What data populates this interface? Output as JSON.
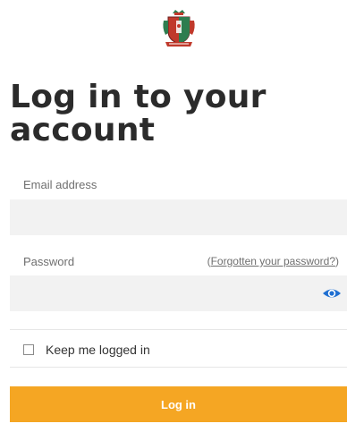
{
  "header": {
    "logo_icon": "crest-logo-icon"
  },
  "page": {
    "title_line1": "Log in to your",
    "title_line2": "account"
  },
  "form": {
    "email_label": "Email address",
    "email_value": "",
    "password_label": "Password",
    "password_value": "",
    "forgot_open": "(",
    "forgot_link": "Forgotten your password?",
    "forgot_close": ")",
    "show_password_icon": "eye-icon",
    "remember_label": "Keep me logged in",
    "remember_checked": false,
    "submit_label": "Log in"
  },
  "colors": {
    "accent": "#f5a623",
    "eye_icon": "#1f6fd1",
    "input_bg": "#f2f2f2"
  }
}
